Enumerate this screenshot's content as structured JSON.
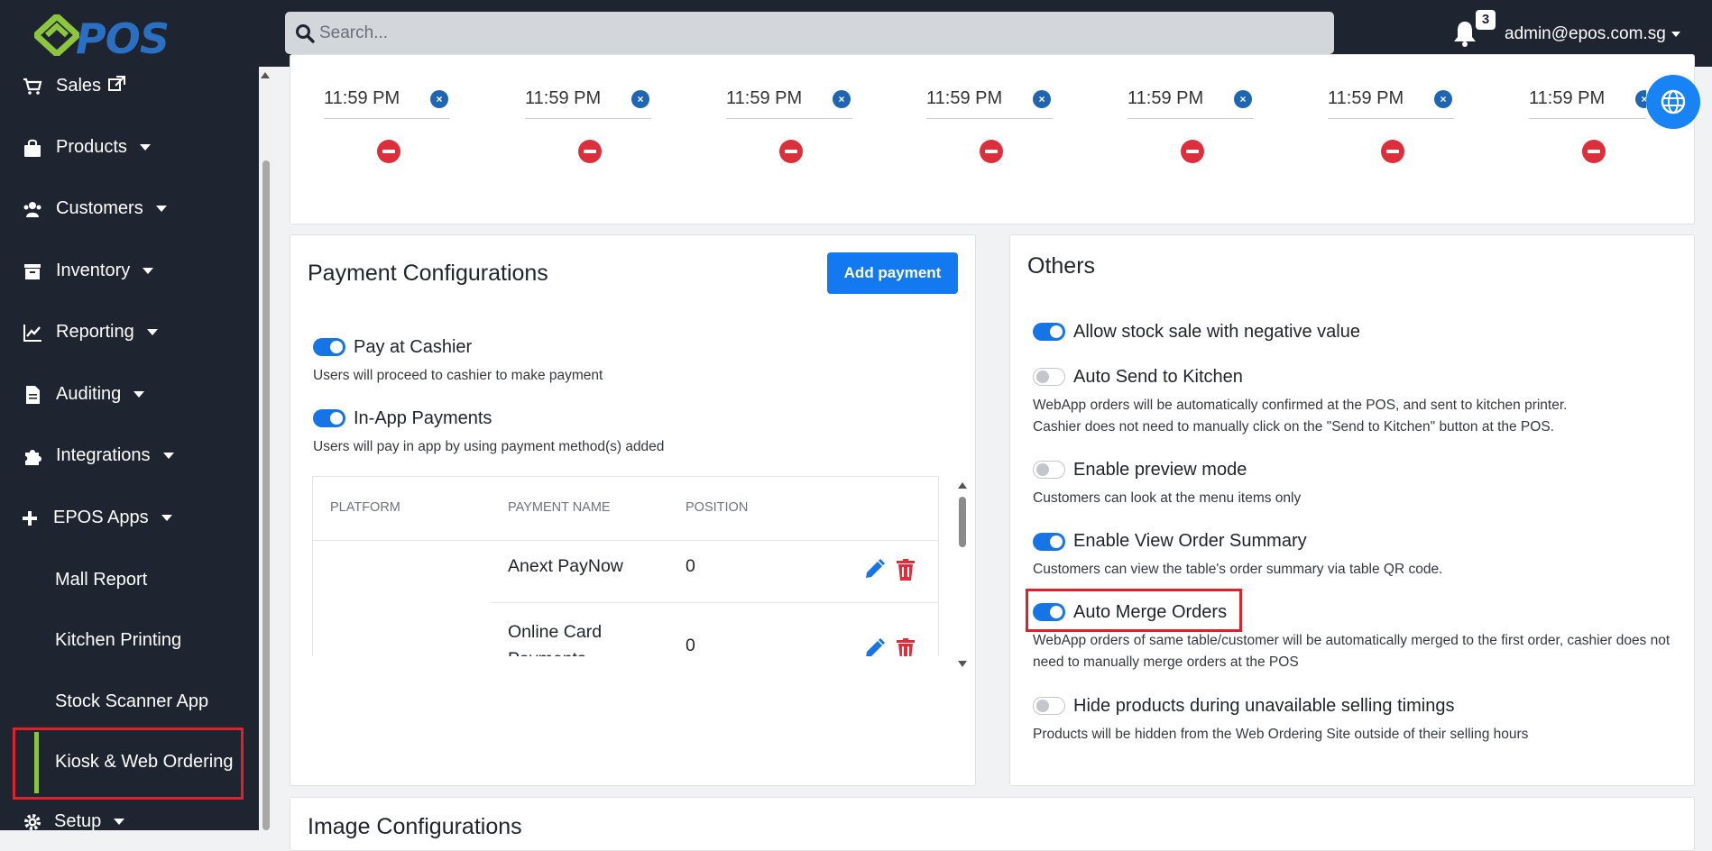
{
  "header": {
    "logo_text": "POS",
    "search_placeholder": "Search...",
    "notification_count": "3",
    "user_email": "admin@epos.com.sg"
  },
  "sidebar": {
    "items": [
      {
        "label": "Sales",
        "icon": "cart-icon"
      },
      {
        "label": "Products",
        "icon": "bag-icon"
      },
      {
        "label": "Customers",
        "icon": "users-icon"
      },
      {
        "label": "Inventory",
        "icon": "archive-icon"
      },
      {
        "label": "Reporting",
        "icon": "chart-line-icon"
      },
      {
        "label": "Auditing",
        "icon": "file-icon"
      },
      {
        "label": "Integrations",
        "icon": "puzzle-icon"
      },
      {
        "label": "EPOS Apps",
        "icon": "plus-icon"
      }
    ],
    "sub_items": [
      "Mall Report",
      "Kitchen Printing",
      "Stock Scanner App",
      "Kiosk & Web Ordering"
    ],
    "setup_label": "Setup"
  },
  "timings": {
    "values": [
      "11:59 PM",
      "11:59 PM",
      "11:59 PM",
      "11:59 PM",
      "11:59 PM",
      "11:59 PM",
      "11:59 PM"
    ]
  },
  "payment": {
    "title": "Payment Configurations",
    "add_button": "Add payment",
    "options": [
      {
        "label": "Pay at Cashier",
        "desc": "Users will proceed to cashier to make payment",
        "on": true
      },
      {
        "label": "In-App Payments",
        "desc": "Users will pay in app by using payment method(s) added",
        "on": true
      }
    ],
    "table": {
      "headers": [
        "PLATFORM",
        "PAYMENT NAME",
        "POSITION"
      ],
      "rows": [
        {
          "platform": "",
          "name": "Anext PayNow",
          "position": "0"
        },
        {
          "platform": "",
          "name": "Online Card Payments",
          "position": "0"
        }
      ]
    }
  },
  "others": {
    "title": "Others",
    "options": [
      {
        "label": "Allow stock sale with negative value",
        "desc": "",
        "on": true
      },
      {
        "label": "Auto Send to Kitchen",
        "desc": "WebApp orders will be automatically confirmed at the POS, and sent to kitchen printer. Cashier does not need to manually click on the \"Send to Kitchen\" button at the POS.",
        "on": false
      },
      {
        "label": "Enable preview mode",
        "desc": "Customers can look at the menu items only",
        "on": false
      },
      {
        "label": "Enable View Order Summary",
        "desc": "Customers can view the table's order summary via table QR code.",
        "on": true
      },
      {
        "label": "Auto Merge Orders",
        "desc": "WebApp orders of same table/customer will be automatically merged to the first order, cashier does not need to manually merge orders at the POS",
        "on": true
      },
      {
        "label": "Hide products during unavailable selling timings",
        "desc": "Products will be hidden from the Web Ordering Site outside of their selling hours",
        "on": false
      }
    ]
  },
  "image_config": {
    "title": "Image Configurations"
  },
  "colors": {
    "sidebar_bg": "#1f2431",
    "accent": "#1379f0",
    "danger": "#dc2f3c",
    "highlight": "#e0202a",
    "active_bar": "#8cc63f"
  }
}
